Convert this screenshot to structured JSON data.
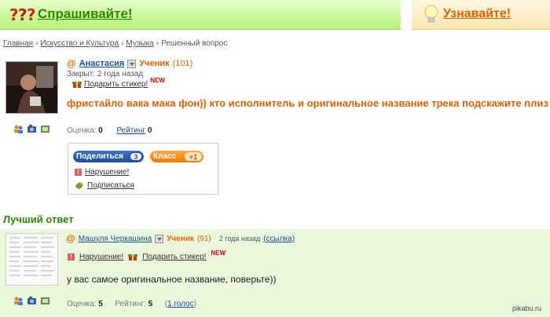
{
  "header": {
    "ask_label": "Спрашивайте!",
    "learn_label": "Узнавайте!",
    "ask_bg": "#b8f27a",
    "learn_bg": "#fde6b0",
    "ask_color": "#2d8a00",
    "learn_color": "#e86100"
  },
  "breadcrumb": {
    "items": [
      "Главная",
      "Искусство и Культура",
      "Музыка"
    ],
    "current": "Решенный вопрос",
    "separator": "›"
  },
  "question": {
    "user": {
      "at": "@",
      "name": "Анастасия",
      "rank": "Ученик",
      "points": "(101)"
    },
    "closed": "Закрыт: 2 года назад",
    "sticker_label": "Подарить стикер!",
    "new_badge": "NEW",
    "text": "фристайло вака мака фон)) кто исполнитель и оригинальное название трека подскажите плиз",
    "rating_label": "Оценка:",
    "rating_value": "0",
    "rank_link": "Рейтинг",
    "rank_value": "0",
    "share": {
      "share_label": "Поделиться",
      "share_count": "3",
      "class_label": "Класс",
      "class_count": "+1",
      "report_label": "Нарушение!",
      "subscribe_label": "Подписаться"
    }
  },
  "best_answer": {
    "title": "Лучший ответ",
    "user": {
      "at": "@",
      "name": "Машуля Черкашина",
      "rank": "Ученик",
      "points": "(91)"
    },
    "time": "2 года назад",
    "link_label": "(ссылка)",
    "report_label": "Нарушение!",
    "sticker_label": "Подарить стикер!",
    "new_badge": "NEW",
    "text": "у вас самое оригинальное название, поверьте))",
    "rating_label": "Оценка:",
    "rating_value": "5",
    "rank_label": "Рейтинг:",
    "rank_value": "5",
    "votes_label": "1 голос"
  },
  "watermark": "pikabu.ru",
  "icons": [
    "question-marks-icon",
    "bulb-icon",
    "friends-icon",
    "photo-icon",
    "video-icon",
    "gift-icon",
    "warning-icon",
    "subscribe-icon",
    "dropdown-icon"
  ]
}
